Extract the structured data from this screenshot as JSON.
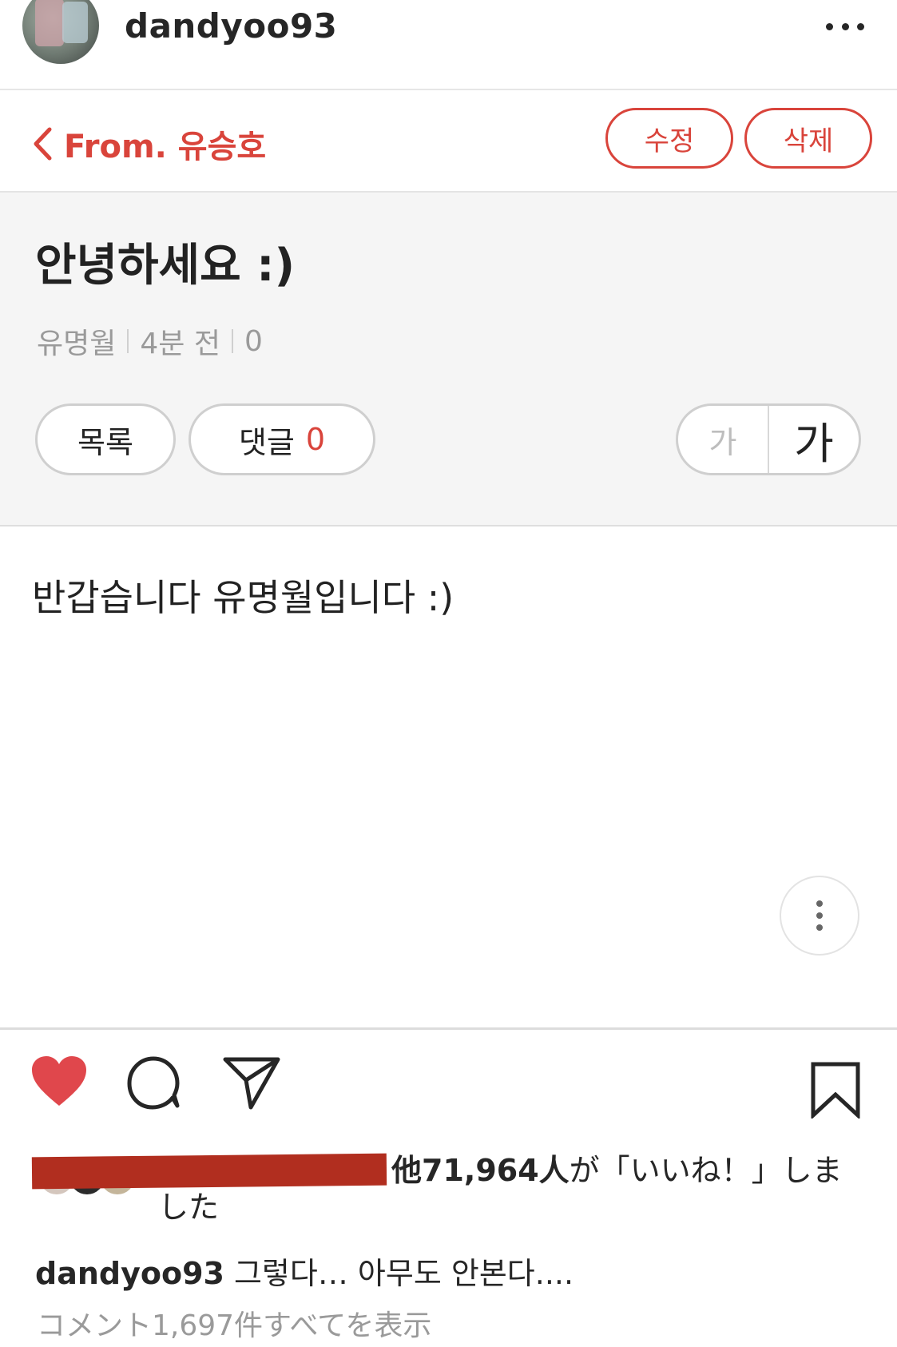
{
  "header": {
    "username": "dandyoo93",
    "more_icon": "more-horizontal-icon"
  },
  "post": {
    "back_label": "From. 유승호",
    "edit_label": "수정",
    "delete_label": "삭제",
    "title": "안녕하세요 :)",
    "author": "유명월",
    "time": "4분 전",
    "views": "0",
    "list_label": "목록",
    "comment_label": "댓글",
    "comment_count": "0",
    "font_small_label": "가",
    "font_large_label": "가",
    "body": "반갑습니다 유명월입니다 :)"
  },
  "actions": {
    "like_icon": "heart-filled-icon",
    "comment_icon": "comment-icon",
    "share_icon": "send-icon",
    "bookmark_icon": "bookmark-icon",
    "like_color": "#e0474c"
  },
  "likes": {
    "count_text": "他71,964人",
    "tail": "が「いいね！」しま",
    "tail_cont": "した"
  },
  "caption": {
    "username": "dandyoo93",
    "text": "그렇다… 아무도 안본다...."
  },
  "view_comments": "コメント1,697件すべてを表示",
  "colors": {
    "accent_red": "#d9443b",
    "redaction": "#b12e1f"
  }
}
